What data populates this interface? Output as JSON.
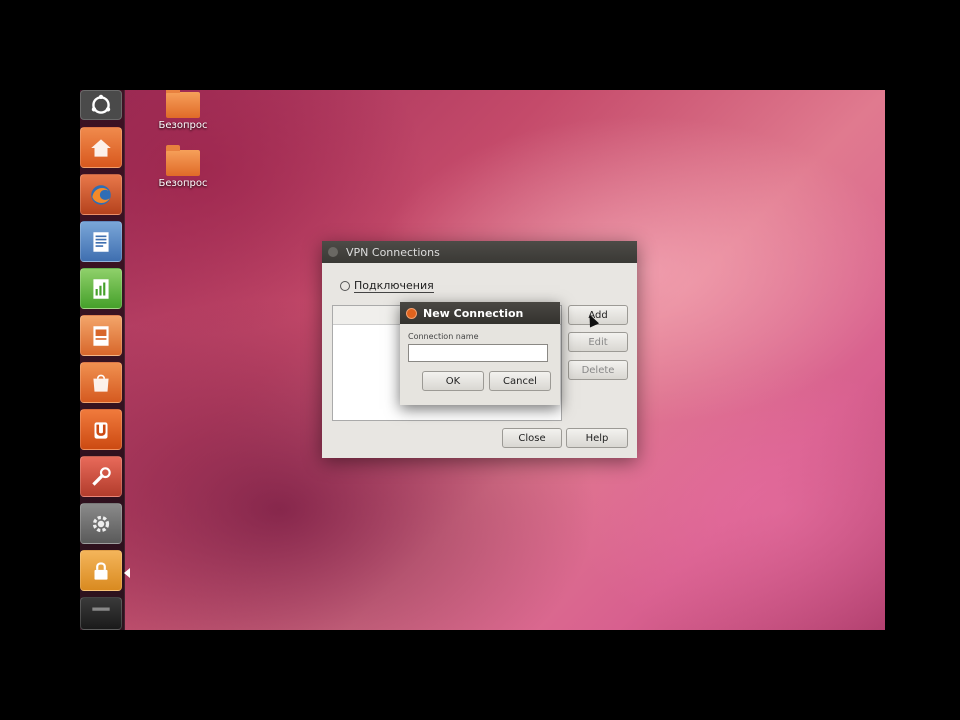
{
  "desktop": {
    "icons": [
      {
        "label": "Безопрос",
        "icon": "folder-icon"
      },
      {
        "label": "Безопрос",
        "icon": "folder-icon"
      }
    ]
  },
  "launcher": {
    "items": [
      {
        "name": "dash",
        "icon": "ubuntu-logo-icon"
      },
      {
        "name": "home-folder",
        "icon": "home-folder-icon"
      },
      {
        "name": "firefox",
        "icon": "firefox-icon"
      },
      {
        "name": "libreoffice-writer",
        "icon": "writer-icon"
      },
      {
        "name": "libreoffice-calc",
        "icon": "calc-icon"
      },
      {
        "name": "libreoffice-impress",
        "icon": "impress-icon"
      },
      {
        "name": "software-center",
        "icon": "software-center-icon"
      },
      {
        "name": "ubuntu-one",
        "icon": "ubuntu-one-icon"
      },
      {
        "name": "tweak-tool",
        "icon": "tools-icon"
      },
      {
        "name": "system-settings",
        "icon": "gear-icon"
      },
      {
        "name": "vpn-connections",
        "icon": "lock-icon"
      },
      {
        "name": "workspaces",
        "icon": "workspace-icon"
      }
    ]
  },
  "vpn_window": {
    "title": "VPN Connections",
    "tab_label": "Подключения",
    "buttons": {
      "add": "Add",
      "edit": "Edit",
      "delete": "Delete",
      "close": "Close",
      "help": "Help"
    }
  },
  "new_connection": {
    "title": "New Connection",
    "field_label": "Connection name",
    "field_value": "",
    "ok": "OK",
    "cancel": "Cancel"
  },
  "colors": {
    "accent": "#e0631e",
    "titlebar": "#3a3935",
    "wallpaper": "#c44a6a"
  }
}
